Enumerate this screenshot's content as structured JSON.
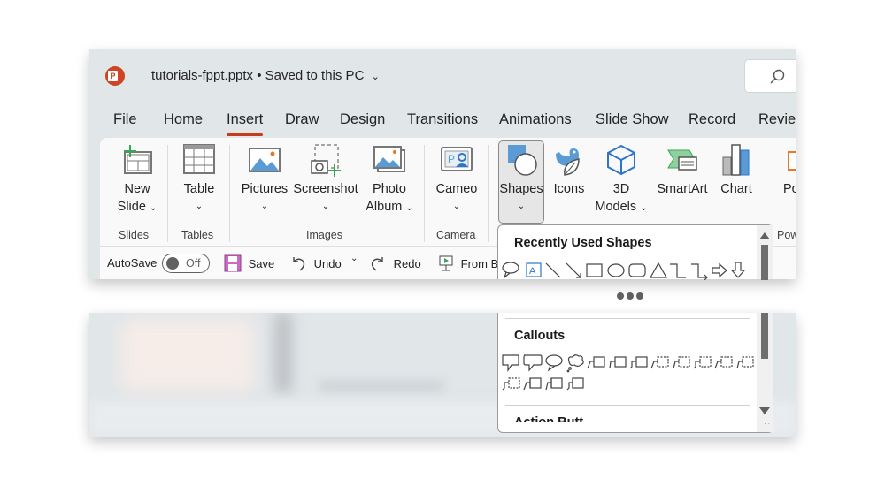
{
  "app": {
    "logo_letter": "P",
    "file_name": "tutorials-fppt.pptx",
    "separator": "•",
    "save_status": "Saved to this PC",
    "search_icon": "search-icon"
  },
  "tabs": [
    {
      "label": "File",
      "active": false
    },
    {
      "label": "Home",
      "active": false
    },
    {
      "label": "Insert",
      "active": true
    },
    {
      "label": "Draw",
      "active": false
    },
    {
      "label": "Design",
      "active": false
    },
    {
      "label": "Transitions",
      "active": false
    },
    {
      "label": "Animations",
      "active": false
    },
    {
      "label": "Slide Show",
      "active": false
    },
    {
      "label": "Record",
      "active": false
    },
    {
      "label": "Review",
      "active": false
    }
  ],
  "ribbon": {
    "groups": {
      "slides": "Slides",
      "tables": "Tables",
      "images": "Images",
      "camera": "Camera",
      "power": "Pow"
    },
    "buttons": {
      "new_slide_1": "New",
      "new_slide_2": "Slide",
      "table": "Table",
      "pictures": "Pictures",
      "screenshot": "Screenshot",
      "photo_album_1": "Photo",
      "photo_album_2": "Album",
      "cameo": "Cameo",
      "shapes": "Shapes",
      "icons": "Icons",
      "models_1": "3D",
      "models_2": "Models",
      "smartart": "SmartArt",
      "chart": "Chart",
      "power_partial": "Po"
    },
    "dropdown_glyph": "⌄"
  },
  "qat": {
    "autosave_label": "AutoSave",
    "autosave_state": "Off",
    "save": "Save",
    "undo": "Undo",
    "redo": "Redo",
    "from_beginning": "From Be"
  },
  "shapes_panel": {
    "recently_used_title": "Recently Used Shapes",
    "recent_shapes": [
      "speech-bubble-oval",
      "text-box",
      "line",
      "arrow-line",
      "rectangle",
      "oval",
      "rounded-rectangle",
      "triangle",
      "elbow-connector",
      "elbow-arrow-connector",
      "right-arrow",
      "down-arrow"
    ],
    "callouts_title": "Callouts",
    "callout_shapes_count": 16,
    "next_section_partial": "Action Butt"
  },
  "colors": {
    "accent": "#c43e1c",
    "icon_blue": "#5b9bd5",
    "icon_green": "#3aa655"
  }
}
